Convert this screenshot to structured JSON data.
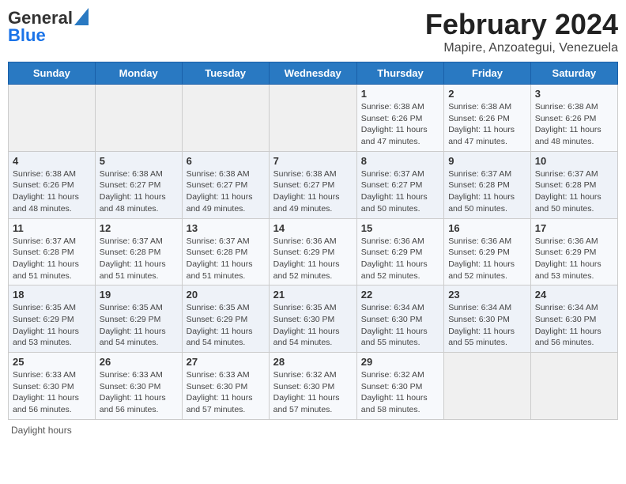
{
  "header": {
    "logo_general": "General",
    "logo_blue": "Blue",
    "month_title": "February 2024",
    "location": "Mapire, Anzoategui, Venezuela"
  },
  "days_of_week": [
    "Sunday",
    "Monday",
    "Tuesday",
    "Wednesday",
    "Thursday",
    "Friday",
    "Saturday"
  ],
  "weeks": [
    [
      {
        "day": "",
        "info": ""
      },
      {
        "day": "",
        "info": ""
      },
      {
        "day": "",
        "info": ""
      },
      {
        "day": "",
        "info": ""
      },
      {
        "day": "1",
        "info": "Sunrise: 6:38 AM\nSunset: 6:26 PM\nDaylight: 11 hours and 47 minutes."
      },
      {
        "day": "2",
        "info": "Sunrise: 6:38 AM\nSunset: 6:26 PM\nDaylight: 11 hours and 47 minutes."
      },
      {
        "day": "3",
        "info": "Sunrise: 6:38 AM\nSunset: 6:26 PM\nDaylight: 11 hours and 48 minutes."
      }
    ],
    [
      {
        "day": "4",
        "info": "Sunrise: 6:38 AM\nSunset: 6:26 PM\nDaylight: 11 hours and 48 minutes."
      },
      {
        "day": "5",
        "info": "Sunrise: 6:38 AM\nSunset: 6:27 PM\nDaylight: 11 hours and 48 minutes."
      },
      {
        "day": "6",
        "info": "Sunrise: 6:38 AM\nSunset: 6:27 PM\nDaylight: 11 hours and 49 minutes."
      },
      {
        "day": "7",
        "info": "Sunrise: 6:38 AM\nSunset: 6:27 PM\nDaylight: 11 hours and 49 minutes."
      },
      {
        "day": "8",
        "info": "Sunrise: 6:37 AM\nSunset: 6:27 PM\nDaylight: 11 hours and 50 minutes."
      },
      {
        "day": "9",
        "info": "Sunrise: 6:37 AM\nSunset: 6:28 PM\nDaylight: 11 hours and 50 minutes."
      },
      {
        "day": "10",
        "info": "Sunrise: 6:37 AM\nSunset: 6:28 PM\nDaylight: 11 hours and 50 minutes."
      }
    ],
    [
      {
        "day": "11",
        "info": "Sunrise: 6:37 AM\nSunset: 6:28 PM\nDaylight: 11 hours and 51 minutes."
      },
      {
        "day": "12",
        "info": "Sunrise: 6:37 AM\nSunset: 6:28 PM\nDaylight: 11 hours and 51 minutes."
      },
      {
        "day": "13",
        "info": "Sunrise: 6:37 AM\nSunset: 6:28 PM\nDaylight: 11 hours and 51 minutes."
      },
      {
        "day": "14",
        "info": "Sunrise: 6:36 AM\nSunset: 6:29 PM\nDaylight: 11 hours and 52 minutes."
      },
      {
        "day": "15",
        "info": "Sunrise: 6:36 AM\nSunset: 6:29 PM\nDaylight: 11 hours and 52 minutes."
      },
      {
        "day": "16",
        "info": "Sunrise: 6:36 AM\nSunset: 6:29 PM\nDaylight: 11 hours and 52 minutes."
      },
      {
        "day": "17",
        "info": "Sunrise: 6:36 AM\nSunset: 6:29 PM\nDaylight: 11 hours and 53 minutes."
      }
    ],
    [
      {
        "day": "18",
        "info": "Sunrise: 6:35 AM\nSunset: 6:29 PM\nDaylight: 11 hours and 53 minutes."
      },
      {
        "day": "19",
        "info": "Sunrise: 6:35 AM\nSunset: 6:29 PM\nDaylight: 11 hours and 54 minutes."
      },
      {
        "day": "20",
        "info": "Sunrise: 6:35 AM\nSunset: 6:29 PM\nDaylight: 11 hours and 54 minutes."
      },
      {
        "day": "21",
        "info": "Sunrise: 6:35 AM\nSunset: 6:30 PM\nDaylight: 11 hours and 54 minutes."
      },
      {
        "day": "22",
        "info": "Sunrise: 6:34 AM\nSunset: 6:30 PM\nDaylight: 11 hours and 55 minutes."
      },
      {
        "day": "23",
        "info": "Sunrise: 6:34 AM\nSunset: 6:30 PM\nDaylight: 11 hours and 55 minutes."
      },
      {
        "day": "24",
        "info": "Sunrise: 6:34 AM\nSunset: 6:30 PM\nDaylight: 11 hours and 56 minutes."
      }
    ],
    [
      {
        "day": "25",
        "info": "Sunrise: 6:33 AM\nSunset: 6:30 PM\nDaylight: 11 hours and 56 minutes."
      },
      {
        "day": "26",
        "info": "Sunrise: 6:33 AM\nSunset: 6:30 PM\nDaylight: 11 hours and 56 minutes."
      },
      {
        "day": "27",
        "info": "Sunrise: 6:33 AM\nSunset: 6:30 PM\nDaylight: 11 hours and 57 minutes."
      },
      {
        "day": "28",
        "info": "Sunrise: 6:32 AM\nSunset: 6:30 PM\nDaylight: 11 hours and 57 minutes."
      },
      {
        "day": "29",
        "info": "Sunrise: 6:32 AM\nSunset: 6:30 PM\nDaylight: 11 hours and 58 minutes."
      },
      {
        "day": "",
        "info": ""
      },
      {
        "day": "",
        "info": ""
      }
    ]
  ],
  "footer": {
    "daylight_label": "Daylight hours"
  }
}
